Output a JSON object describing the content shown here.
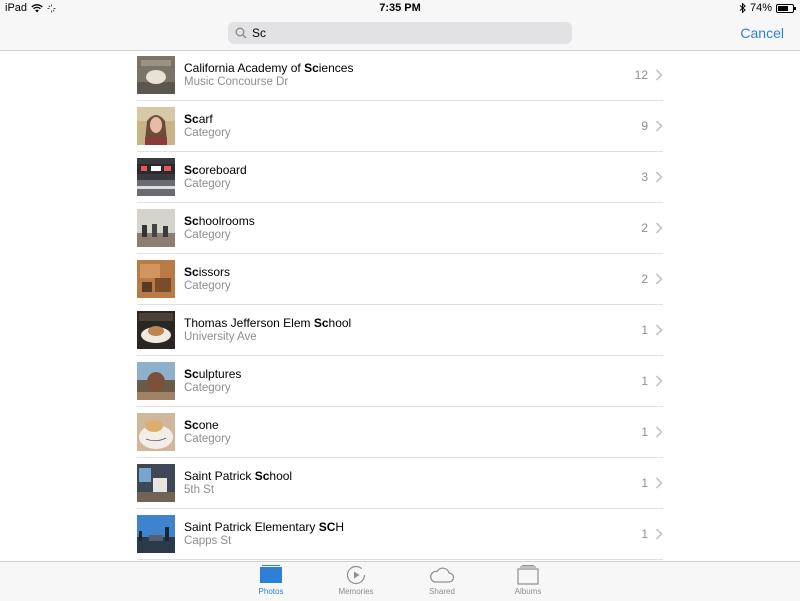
{
  "status": {
    "device": "iPad",
    "time": "7:35 PM",
    "battery": "74%"
  },
  "search": {
    "query": "Sc",
    "cancel_label": "Cancel"
  },
  "results": [
    {
      "pre": "California Academy of ",
      "hl": "Sc",
      "post": "iences",
      "subtitle": "Music Concourse Dr",
      "count": "12",
      "thumb": "academy"
    },
    {
      "pre": "",
      "hl": "Sc",
      "post": "arf",
      "subtitle": "Category",
      "count": "9",
      "thumb": "scarf"
    },
    {
      "pre": "",
      "hl": "Sc",
      "post": "oreboard",
      "subtitle": "Category",
      "count": "3",
      "thumb": "scoreboard"
    },
    {
      "pre": "",
      "hl": "Sc",
      "post": "hoolrooms",
      "subtitle": "Category",
      "count": "2",
      "thumb": "schoolrooms"
    },
    {
      "pre": "",
      "hl": "Sc",
      "post": "issors",
      "subtitle": "Category",
      "count": "2",
      "thumb": "scissors"
    },
    {
      "pre": "Thomas Jefferson Elem ",
      "hl": "Sc",
      "post": "hool",
      "subtitle": "University Ave",
      "count": "1",
      "thumb": "food"
    },
    {
      "pre": "",
      "hl": "Sc",
      "post": "ulptures",
      "subtitle": "Category",
      "count": "1",
      "thumb": "sculpture"
    },
    {
      "pre": "",
      "hl": "Sc",
      "post": "one",
      "subtitle": "Category",
      "count": "1",
      "thumb": "scone"
    },
    {
      "pre": "Saint Patrick ",
      "hl": "Sc",
      "post": "hool",
      "subtitle": "5th St",
      "count": "1",
      "thumb": "desk"
    },
    {
      "pre": "Saint Patrick Elementary ",
      "hl": "SC",
      "post": "H",
      "subtitle": "Capps St",
      "count": "1",
      "thumb": "sky"
    }
  ],
  "tabs": [
    {
      "label": "Photos",
      "icon": "photos-icon",
      "active": true
    },
    {
      "label": "Memories",
      "icon": "memories-icon",
      "active": false
    },
    {
      "label": "Shared",
      "icon": "cloud-icon",
      "active": false
    },
    {
      "label": "Albums",
      "icon": "albums-icon",
      "active": false
    }
  ],
  "colors": {
    "accent": "#2f7fd6",
    "secondary_text": "#8e8e93"
  }
}
